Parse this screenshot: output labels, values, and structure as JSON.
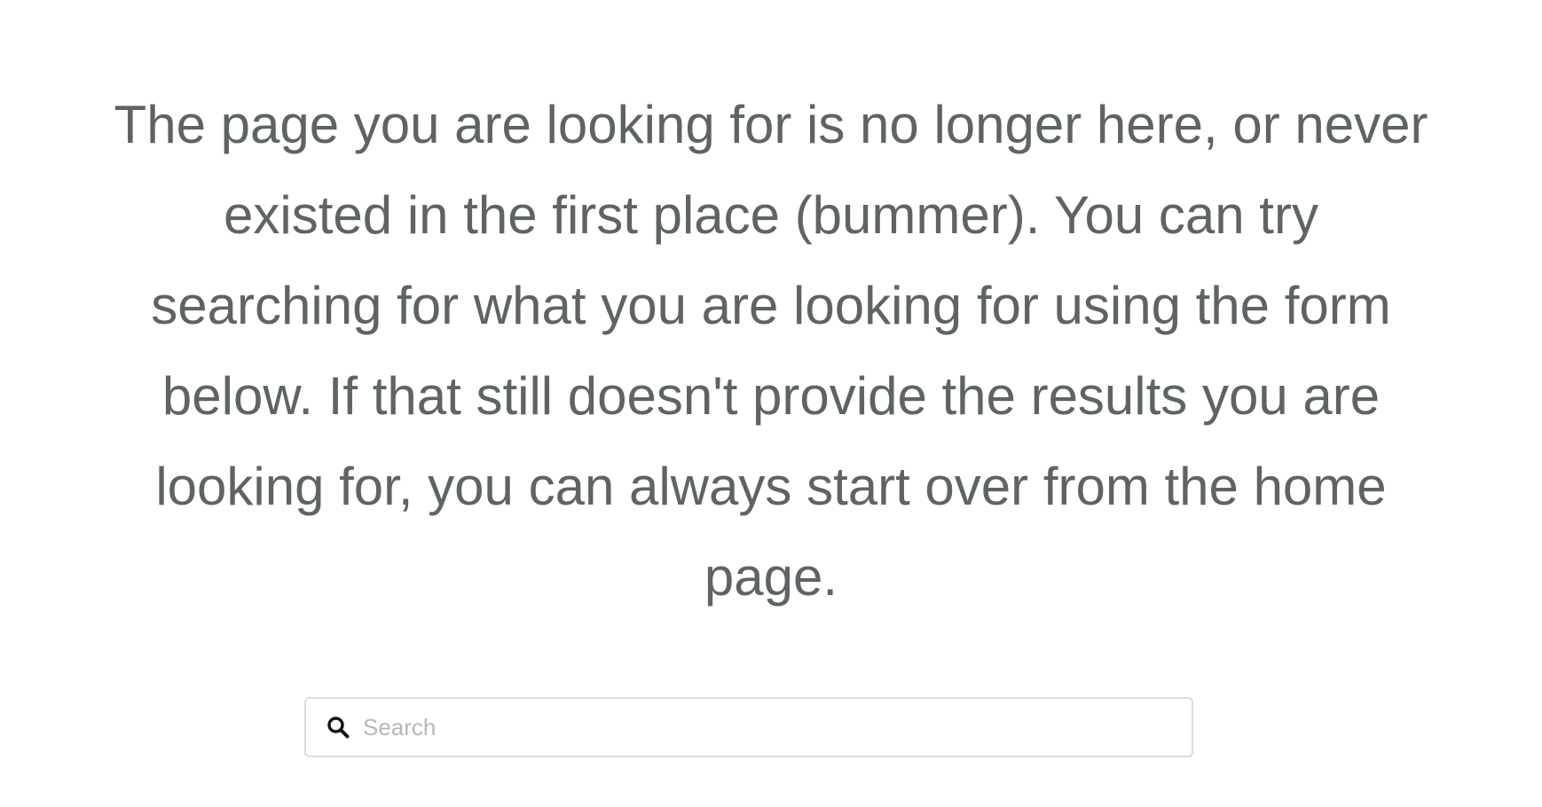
{
  "message": {
    "text": "The page you are looking for is no longer here, or never existed in the first place (bummer). You can try searching for what you are looking for using the form below. If that still doesn't provide the results you are looking for, you can always start over from the home page."
  },
  "search": {
    "placeholder": "Search",
    "value": "",
    "icon": "search-icon"
  },
  "colors": {
    "text": "#5e6366",
    "border": "#dcdcdc",
    "placeholder": "#b5b8ba",
    "icon": "#111111"
  }
}
